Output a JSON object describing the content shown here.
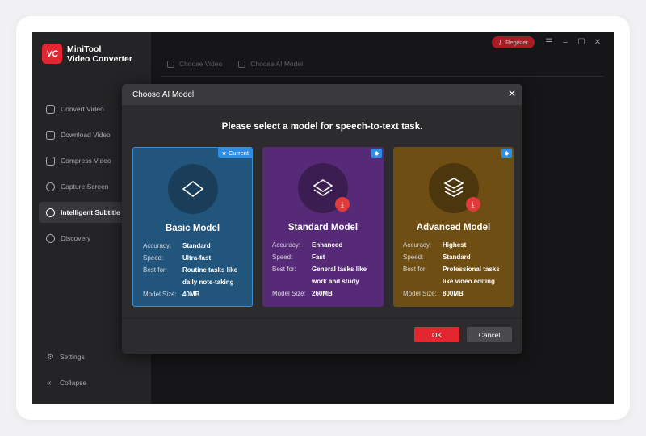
{
  "app": {
    "logo_text": "VC",
    "title_line1": "MiniTool",
    "title_line2": "Video Converter"
  },
  "topbar": {
    "register_label": "Register",
    "accent_color": "#e3262f"
  },
  "sidebar": {
    "items": [
      {
        "label": "Convert Video",
        "icon": "convert-icon"
      },
      {
        "label": "Download Video",
        "icon": "download-icon"
      },
      {
        "label": "Compress Video",
        "icon": "compress-icon"
      },
      {
        "label": "Capture Screen",
        "icon": "capture-icon"
      },
      {
        "label": "Intelligent Subtitle",
        "icon": "subtitle-icon",
        "active": true
      },
      {
        "label": "Discovery",
        "icon": "discovery-icon"
      }
    ],
    "settings_label": "Settings",
    "collapse_label": "Collapse"
  },
  "steps": {
    "step1": "Choose Video",
    "step2": "Choose AI Model"
  },
  "modal": {
    "title": "Choose AI Model",
    "prompt": "Please select a model for speech-to-text task.",
    "ok_label": "OK",
    "cancel_label": "Cancel",
    "labels": {
      "accuracy": "Accuracy:",
      "speed": "Speed:",
      "best_for": "Best for:",
      "model_size": "Model Size:"
    },
    "models": [
      {
        "name": "Basic Model",
        "badge": "Current",
        "accuracy": "Standard",
        "speed": "Ultra-fast",
        "best_for": "Routine tasks like daily note-taking",
        "size": "40MB",
        "color": "#22557c"
      },
      {
        "name": "Standard Model",
        "accuracy": "Enhanced",
        "speed": "Fast",
        "best_for": "General tasks like work and study",
        "size": "260MB",
        "color": "#562a77"
      },
      {
        "name": "Advanced Model",
        "accuracy": "Highest",
        "speed": "Standard",
        "best_for": "Professional tasks like video editing",
        "size": "800MB",
        "color": "#6e4e12"
      }
    ]
  }
}
